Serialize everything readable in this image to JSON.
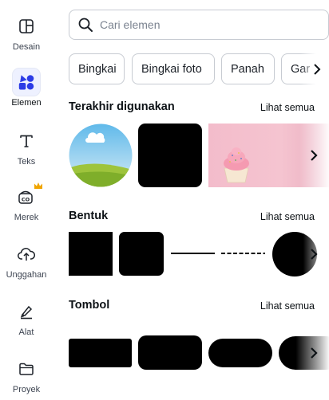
{
  "sidebar": {
    "items": [
      {
        "label": "Desain",
        "icon": "layout-icon"
      },
      {
        "label": "Elemen",
        "icon": "shapes-icon"
      },
      {
        "label": "Teks",
        "icon": "text-icon"
      },
      {
        "label": "Merek",
        "icon": "brand-icon"
      },
      {
        "label": "Unggahan",
        "icon": "cloud-upload-icon"
      },
      {
        "label": "Alat",
        "icon": "pen-tool-icon"
      },
      {
        "label": "Proyek",
        "icon": "folder-icon"
      }
    ],
    "active_index": 1
  },
  "search": {
    "placeholder": "Cari elemen",
    "value": ""
  },
  "chips": [
    "Bingkai",
    "Bingkai foto",
    "Panah",
    "Gar"
  ],
  "sections": {
    "recent": {
      "title": "Terakhir digunakan",
      "link": "Lihat semua"
    },
    "shapes": {
      "title": "Bentuk",
      "link": "Lihat semua"
    },
    "buttons": {
      "title": "Tombol",
      "link": "Lihat semua"
    }
  },
  "colors": {
    "accent": "#7d2ae8",
    "active_bg": "#eef1ff",
    "brand_icon": "#2c3ce6",
    "crown": "#f0a500"
  }
}
